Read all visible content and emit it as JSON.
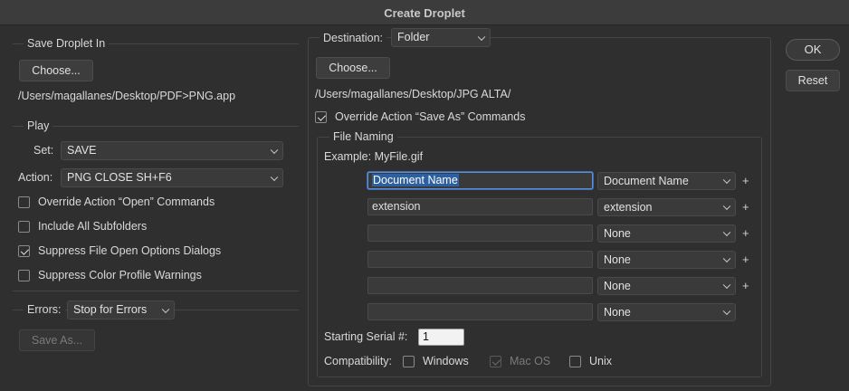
{
  "window": {
    "title": "Create Droplet"
  },
  "save_droplet": {
    "group_label": "Save Droplet In",
    "choose_label": "Choose...",
    "path": "/Users/magallanes/Desktop/PDF>PNG.app"
  },
  "play": {
    "group_label": "Play",
    "set_label": "Set:",
    "set_value": "SAVE",
    "action_label": "Action:",
    "action_value": "PNG CLOSE SH+F6",
    "options": [
      {
        "label": "Override Action “Open” Commands",
        "checked": false
      },
      {
        "label": "Include All Subfolders",
        "checked": false
      },
      {
        "label": "Suppress File Open Options Dialogs",
        "checked": true
      },
      {
        "label": "Suppress Color Profile Warnings",
        "checked": false
      }
    ]
  },
  "errors": {
    "label": "Errors:",
    "value": "Stop for Errors",
    "save_as_label": "Save As..."
  },
  "destination": {
    "label": "Destination:",
    "value": "Folder",
    "choose_label": "Choose...",
    "path": "/Users/magallanes/Desktop/JPG ALTA/",
    "override_label": "Override Action “Save As” Commands",
    "override_checked": true
  },
  "file_naming": {
    "group_label": "File Naming",
    "example_label": "Example: MyFile.gif",
    "rows": [
      {
        "field": "Document Name",
        "select": "Document Name",
        "plus": "+"
      },
      {
        "field": "extension",
        "select": "extension",
        "plus": "+"
      },
      {
        "field": "",
        "select": "None",
        "plus": "+"
      },
      {
        "field": "",
        "select": "None",
        "plus": "+"
      },
      {
        "field": "",
        "select": "None",
        "plus": "+"
      },
      {
        "field": "",
        "select": "None",
        "plus": ""
      }
    ],
    "serial_label": "Starting Serial #:",
    "serial_value": "1",
    "compat_label": "Compatibility:",
    "compat": [
      {
        "label": "Windows",
        "checked": false,
        "enabled": true
      },
      {
        "label": "Mac OS",
        "checked": true,
        "enabled": false
      },
      {
        "label": "Unix",
        "checked": false,
        "enabled": true
      }
    ]
  },
  "buttons": {
    "ok": "OK",
    "reset": "Reset"
  }
}
